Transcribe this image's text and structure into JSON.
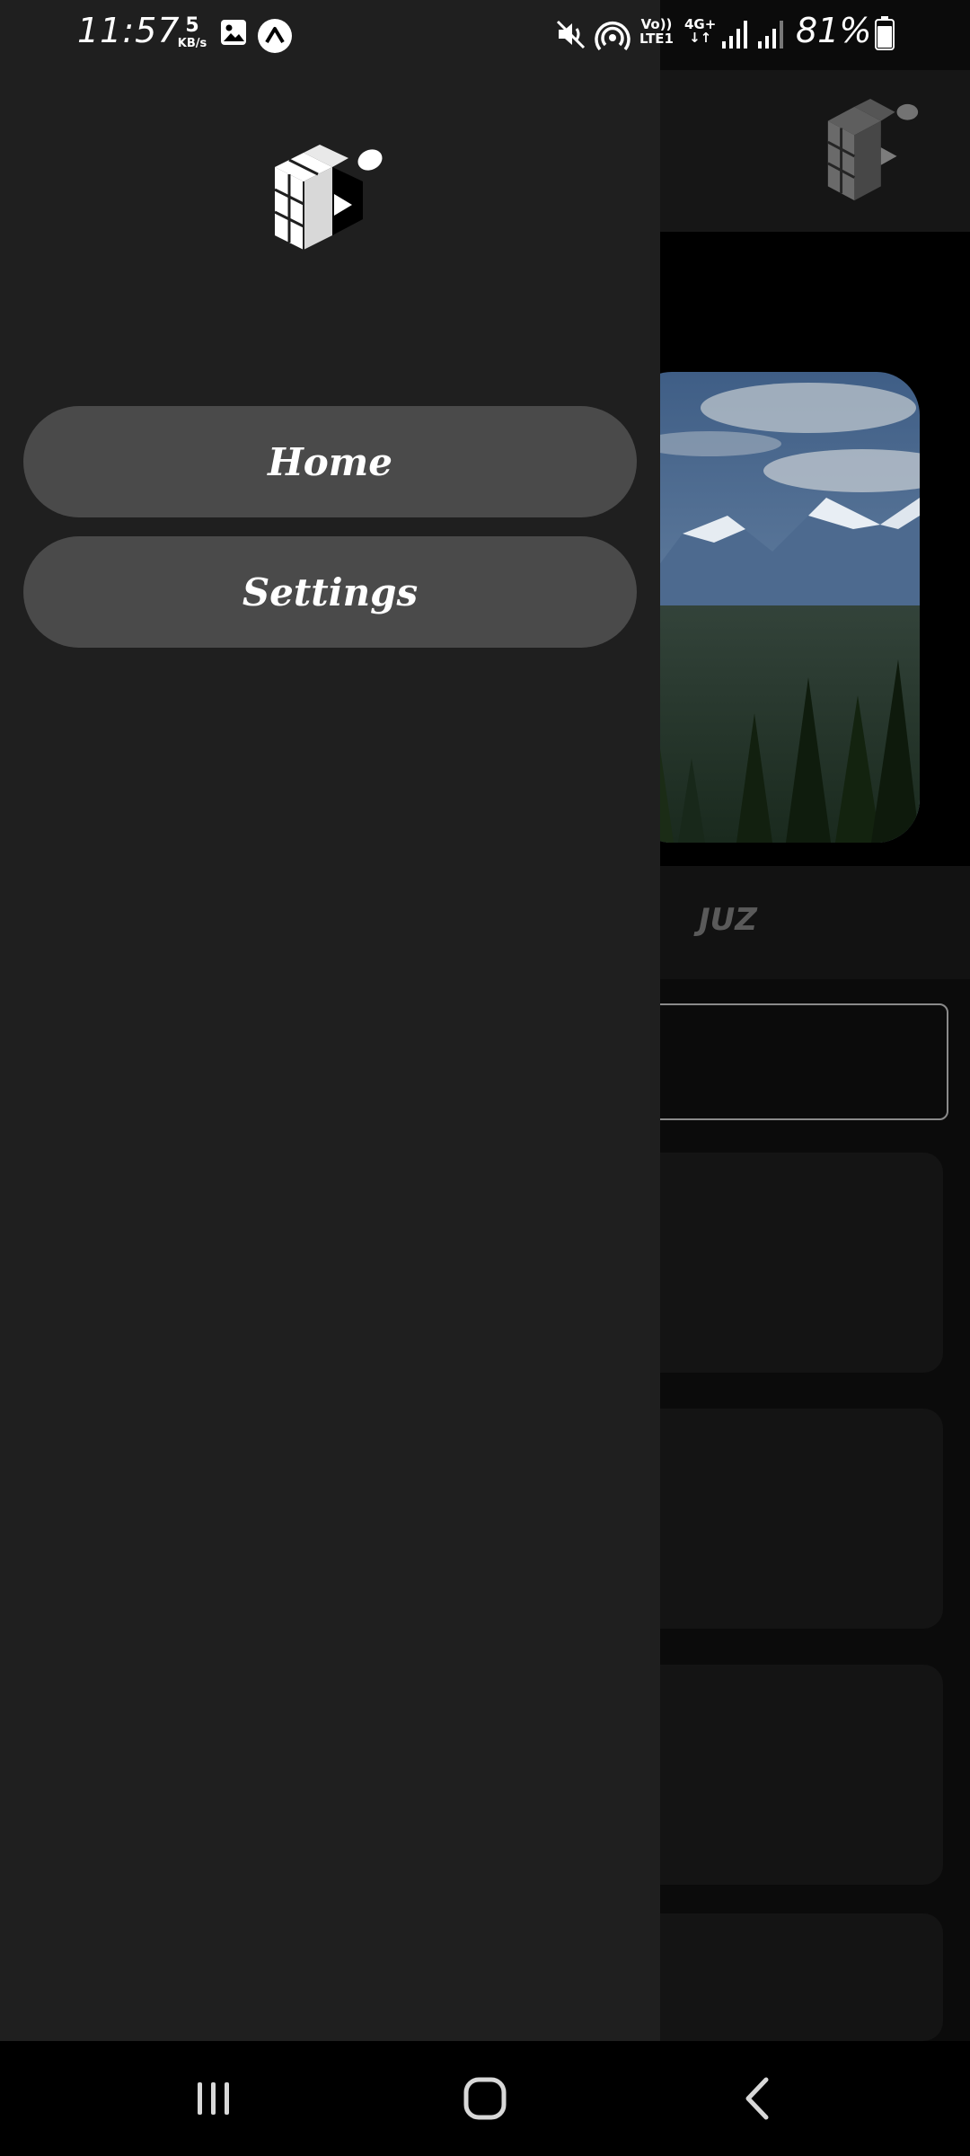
{
  "status_bar": {
    "time": "11:57",
    "net_speed_value": "5",
    "net_speed_unit": "KB/s",
    "volte_top": "Vo))",
    "volte_bottom": "LTE1",
    "network_type": "4G+",
    "battery_percent": "81%",
    "icons": [
      "gallery-icon",
      "app-notification-icon",
      "mute-icon",
      "hotspot-icon",
      "signal-icon",
      "signal-icon-2",
      "battery-icon"
    ]
  },
  "drawer": {
    "logo_icon": "cube-logo-icon",
    "items": [
      {
        "label": "Home"
      },
      {
        "label": "Settings"
      }
    ]
  },
  "background_app": {
    "tab_label": "JUZ",
    "logo_icon": "cube-logo-icon",
    "image_subject": "mountain-landscape"
  },
  "nav_bar": {
    "icons": [
      "recents-icon",
      "home-icon",
      "back-icon"
    ]
  },
  "colors": {
    "drawer_bg": "#1f1f1f",
    "drawer_button_bg": "#4a4a4a",
    "nav_bg": "#000000"
  }
}
